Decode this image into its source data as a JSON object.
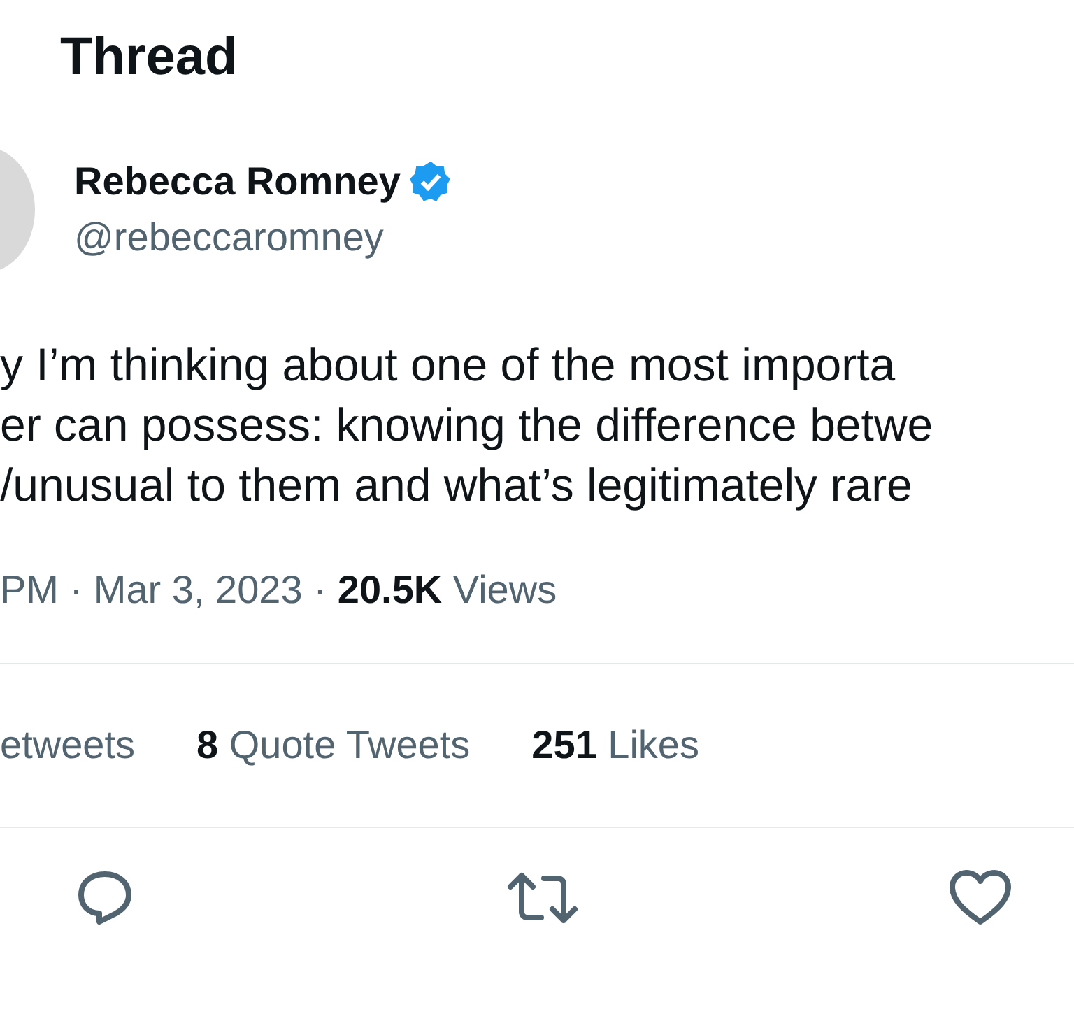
{
  "header": {
    "title": "Thread"
  },
  "author": {
    "name": "Rebecca Romney",
    "verified": true,
    "handle": "@rebeccaromney"
  },
  "tweet": {
    "lines": [
      "y I’m thinking about one of the most importa",
      "er can possess: knowing the difference betwe",
      "/unusual to them and what’s legitimately rare"
    ]
  },
  "meta": {
    "time": "PM · Mar 3, 2023 ·",
    "views_count": "20.5K",
    "views_label": "Views"
  },
  "stats": [
    {
      "label": "etweets"
    },
    {
      "count": "8",
      "label": "Quote Tweets"
    },
    {
      "count": "251",
      "label": "Likes"
    }
  ],
  "actions": [
    {
      "kind": "reply"
    },
    {
      "kind": "retweet"
    },
    {
      "kind": "like"
    }
  ]
}
